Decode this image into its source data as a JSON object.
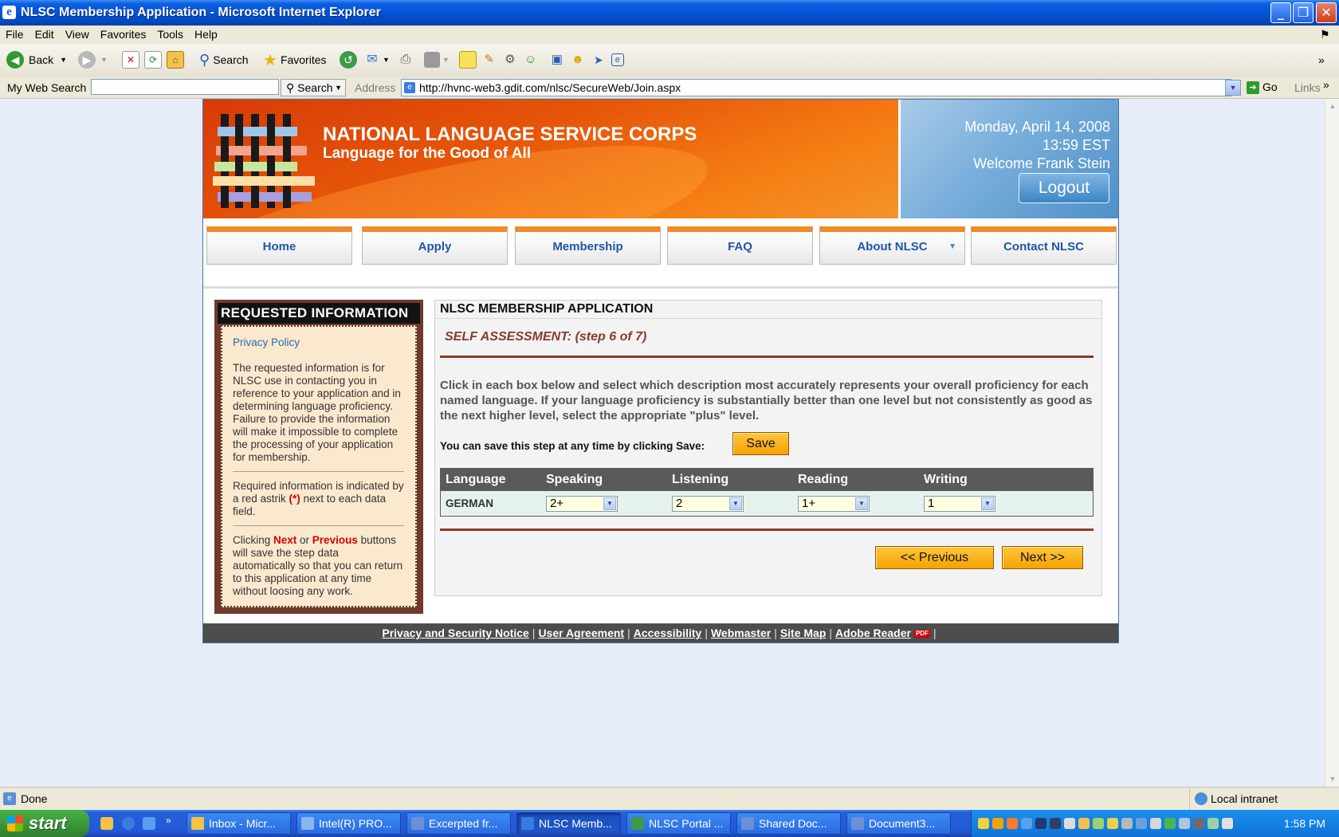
{
  "window": {
    "title": "NLSC Membership Application - Microsoft Internet Explorer"
  },
  "menu": [
    "File",
    "Edit",
    "View",
    "Favorites",
    "Tools",
    "Help"
  ],
  "toolbar": {
    "back": "Back",
    "search": "Search",
    "favorites": "Favorites"
  },
  "address_bar": {
    "web_search_label": "My Web Search",
    "search_button": "Search",
    "address_label": "Address",
    "url": "http://hvnc-web3.gdit.com/nlsc/SecureWeb/Join.aspx",
    "go": "Go",
    "links": "Links"
  },
  "header": {
    "org_name": "NATIONAL LANGUAGE SERVICE CORPS",
    "tagline": "Language for the Good of All",
    "date": "Monday, April 14, 2008",
    "time": "13:59 EST",
    "welcome": "Welcome Frank Stein",
    "logout": "Logout"
  },
  "nav": [
    "Home",
    "Apply",
    "Membership",
    "FAQ",
    "About NLSC",
    "Contact NLSC"
  ],
  "sidebar": {
    "title": "REQUESTED INFORMATION",
    "privacy_link": "Privacy Policy",
    "para1": "The requested information is for NLSC use in contacting you in reference to your application and in determining language proficiency. Failure to provide the information will make it impossible to complete the processing of your application for membership.",
    "para2_a": "Required information is indicated by a red astrik ",
    "para2_mark": "(*)",
    "para2_b": " next to each data field.",
    "para3_a": "Clicking ",
    "para3_next": "Next",
    "para3_or": " or ",
    "para3_prev": "Previous",
    "para3_b": " buttons will save the step data automatically so that you can return to this application at any time without loosing any work."
  },
  "main": {
    "title": "NLSC MEMBERSHIP APPLICATION",
    "step": "SELF ASSESSMENT: (step 6 of 7)",
    "instructions": "Click in each box below and select which description most accurately represents your overall proficiency for each named language. If your language proficiency is substantially better than one level but not consistently as good as the next higher level, select the appropriate \"plus\" level.",
    "save_prompt": "You can save this step at any time by clicking Save:",
    "save": "Save",
    "columns": [
      "Language",
      "Speaking",
      "Listening",
      "Reading",
      "Writing"
    ],
    "rows": [
      {
        "language": "GERMAN",
        "speaking": "2+",
        "listening": "2",
        "reading": "1+",
        "writing": "1"
      }
    ],
    "previous": "<< Previous",
    "next": "Next >>"
  },
  "footer": [
    "Privacy and Security Notice",
    "User Agreement",
    "Accessibility",
    "Webmaster",
    "Site Map",
    "Adobe Reader"
  ],
  "footer_pdf": "PDF",
  "status": {
    "text": "Done",
    "zone": "Local intranet"
  },
  "taskbar": {
    "start": "start",
    "tasks": [
      "Inbox - Micr...",
      "Intel(R) PRO...",
      "Excerpted fr...",
      "NLSC Memb...",
      "NLSC Portal ...",
      "Shared Doc...",
      "Document3..."
    ],
    "clock": "1:58 PM"
  }
}
